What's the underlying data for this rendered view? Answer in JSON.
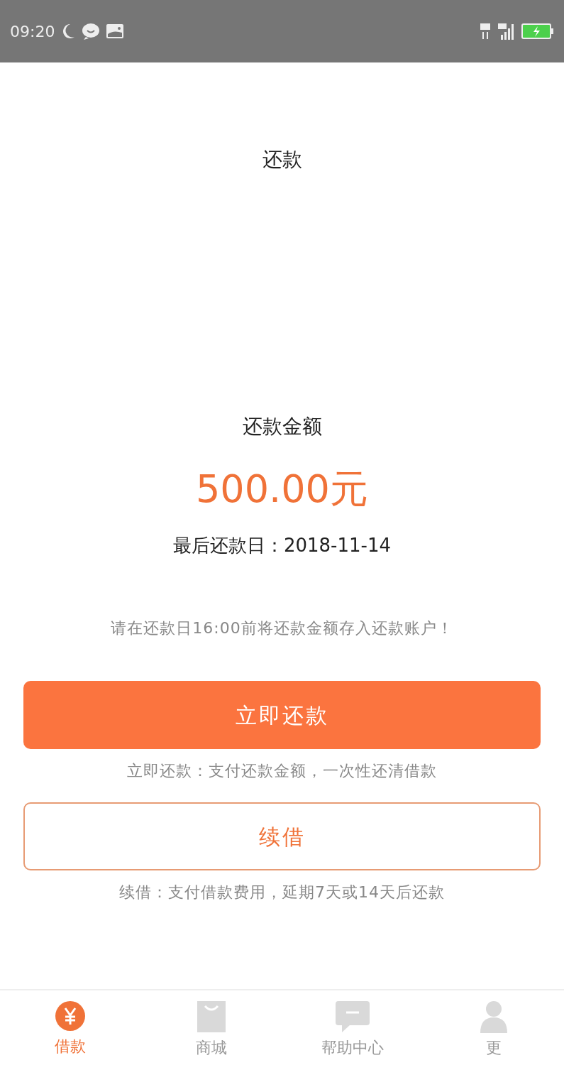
{
  "status_bar": {
    "time": "09:20"
  },
  "header": {
    "title": "还款"
  },
  "repayment": {
    "amount_label": "还款金额",
    "amount": "500.00元",
    "due_label": "最后还款日：",
    "due_date": "2018-11-14",
    "notice": "请在还款日16:00前将还款金额存入还款账户！"
  },
  "actions": [
    {
      "kind": "primary",
      "label": "立即还款",
      "description": "立即还款：支付还款金额，一次性还清借款"
    },
    {
      "kind": "outline",
      "label": "续借",
      "description": "续借：支付借款费用，延期7天或14天后还款"
    }
  ],
  "tabs": [
    {
      "kind": "loan",
      "label": "借款",
      "selected": true
    },
    {
      "kind": "shop",
      "label": "商城",
      "selected": false
    },
    {
      "kind": "help",
      "label": "帮助中心",
      "selected": false
    },
    {
      "kind": "more",
      "label": "更",
      "selected": false
    }
  ]
}
